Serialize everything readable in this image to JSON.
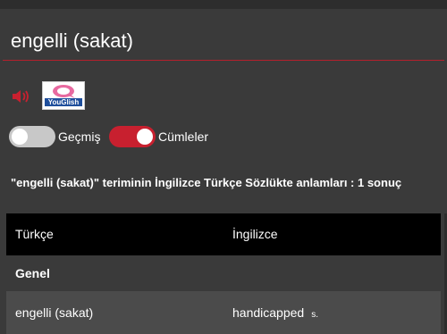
{
  "search": {
    "term": "engelli (sakat)"
  },
  "audio": {
    "icon": "speaker-icon",
    "youglish_label": "YouGlish"
  },
  "toggles": [
    {
      "label": "Geçmiş",
      "state": "off"
    },
    {
      "label": "Cümleler",
      "state": "on"
    }
  ],
  "results": {
    "heading": "\"engelli (sakat)\" teriminin İngilizce Türkçe Sözlükte anlamları : 1 sonuç",
    "columns": [
      "Türkçe",
      "İngilizce"
    ],
    "group": "Genel",
    "rows": [
      {
        "turkish": "engelli (sakat)",
        "english": "handicapped",
        "pos": "s."
      }
    ]
  },
  "colors": {
    "accent": "#c8202f",
    "background": "#3a3a3a",
    "header_bg": "#000000",
    "row_bg": "#4b4b4b"
  }
}
